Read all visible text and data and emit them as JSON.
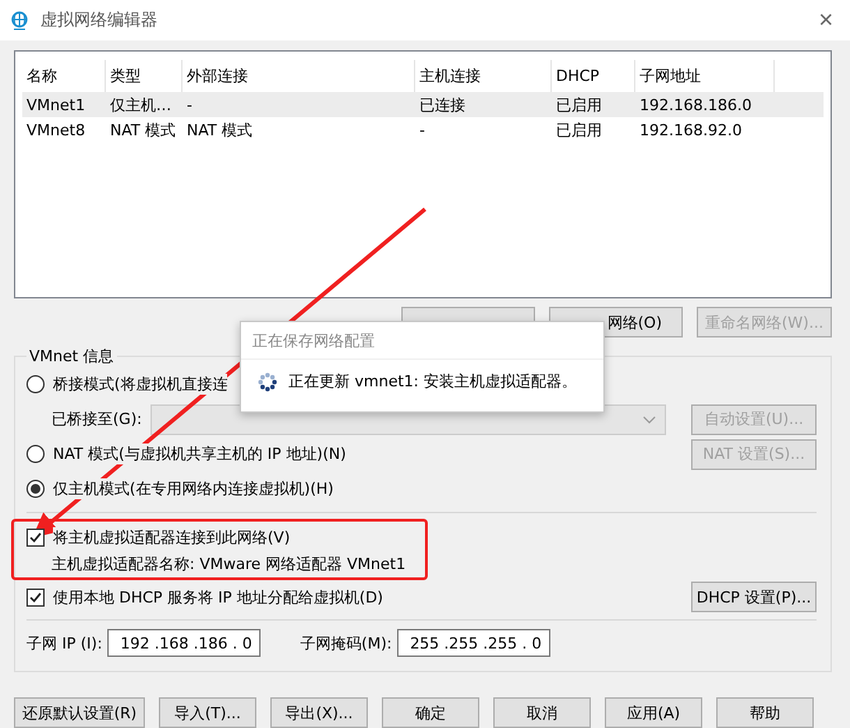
{
  "window": {
    "title": "虚拟网络编辑器",
    "close": "×"
  },
  "table": {
    "columns": [
      "名称",
      "类型",
      "外部连接",
      "主机连接",
      "DHCP",
      "子网地址"
    ],
    "rows": [
      {
        "cells": [
          "VMnet1",
          "仅主机…",
          "-",
          "已连接",
          "已启用",
          "192.168.186.0"
        ],
        "selected": true
      },
      {
        "cells": [
          "VMnet8",
          "NAT 模式",
          "NAT 模式",
          "-",
          "已启用",
          "192.168.92.0"
        ],
        "selected": false
      }
    ]
  },
  "table_buttons": [
    {
      "label": "网络(O)",
      "disabled": false
    },
    {
      "label": "重命名网络(W)...",
      "disabled": true
    }
  ],
  "vmnet_info": {
    "title": "VMnet 信息",
    "modes": [
      {
        "label": "桥接模式(将虚拟机直接连",
        "selected": false
      },
      {
        "label": "NAT 模式(与虚拟机共享主机的 IP 地址)(N)",
        "selected": false
      },
      {
        "label": "仅主机模式(在专用网络内连接虚拟机)(H)",
        "selected": true
      }
    ],
    "bridged_to": {
      "label": "已桥接至(G):",
      "button": {
        "label": "自动设置(U)...",
        "disabled": true
      }
    },
    "nat_button": {
      "label": "NAT 设置(S)...",
      "disabled": true
    },
    "connect_adapter": {
      "label": "将主机虚拟适配器连接到此网络(V)",
      "checked": true,
      "adapter_name": "主机虚拟适配器名称: VMware 网络适配器 VMnet1"
    },
    "dhcp": {
      "label": "使用本地 DHCP 服务将 IP 地址分配给虚拟机(D)",
      "checked": true,
      "button": {
        "label": "DHCP 设置(P)...",
        "disabled": false
      }
    },
    "subnet_ip": {
      "label": "子网 IP (I):",
      "value": "192 .168 .186 . 0"
    },
    "subnet_mask": {
      "label": "子网掩码(M):",
      "value": "255 .255 .255 . 0"
    }
  },
  "footer_buttons": [
    {
      "label": "还原默认设置(R)",
      "disabled": false
    },
    {
      "label": "导入(T)...",
      "disabled": false
    },
    {
      "label": "导出(X)...",
      "disabled": false
    },
    {
      "label": "确定",
      "disabled": false
    },
    {
      "label": "取消",
      "disabled": false
    },
    {
      "label": "应用(A)",
      "disabled": false
    },
    {
      "label": "帮助",
      "disabled": false
    }
  ],
  "progress_popup": {
    "title": "正在保存网络配置",
    "message": "正在更新 vmnet1: 安装主机虚拟适配器。"
  },
  "annotations": {
    "highlight_box": true,
    "arrow": true
  }
}
